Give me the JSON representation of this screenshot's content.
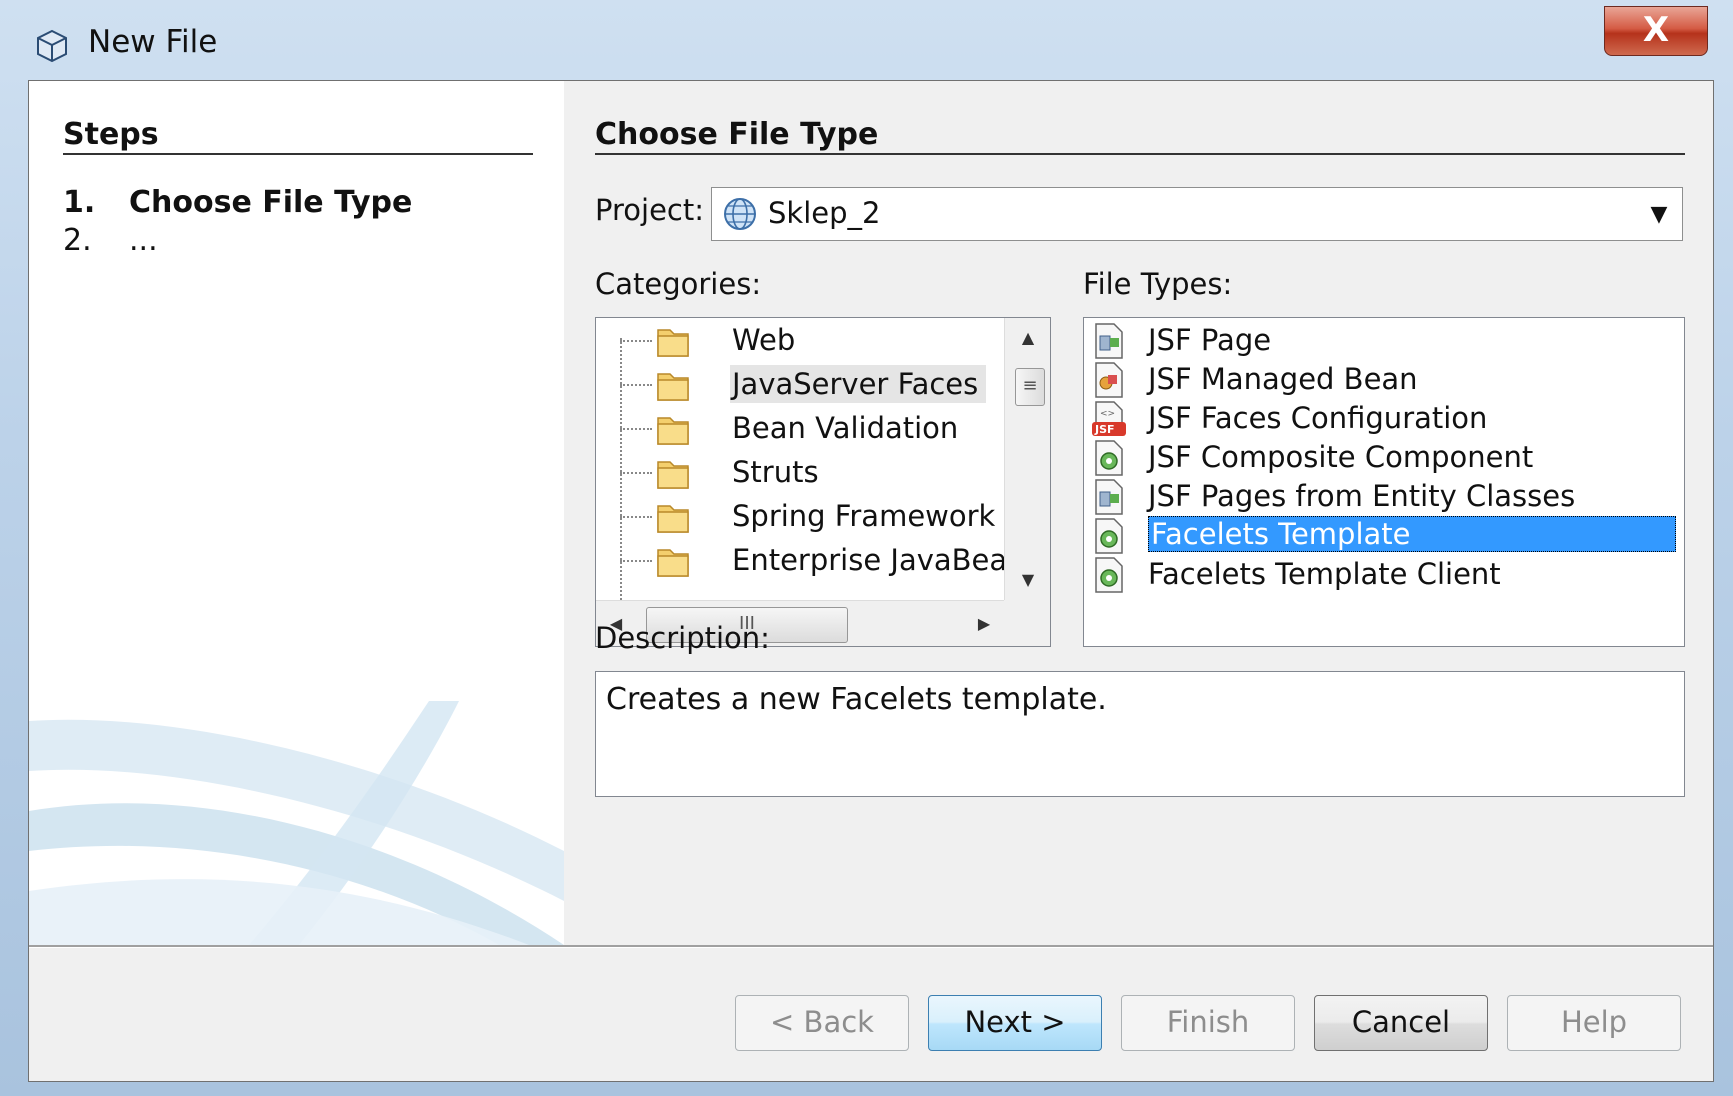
{
  "window": {
    "title": "New File",
    "close_glyph": "X"
  },
  "steps": {
    "heading": "Steps",
    "items": [
      {
        "num": "1.",
        "label": "Choose File Type"
      },
      {
        "num": "2.",
        "label": "..."
      }
    ]
  },
  "main": {
    "heading": "Choose File Type",
    "project_label": "Project:",
    "project_value": "Sklep_2",
    "categories_label": "Categories:",
    "file_types_label": "File Types:",
    "categories": [
      "Web",
      "JavaServer Faces",
      "Bean Validation",
      "Struts",
      "Spring Framework",
      "Enterprise JavaBeans"
    ],
    "categories_selected": "JavaServer Faces",
    "file_types": [
      {
        "label": "JSF Page",
        "icon": "jsf-page-icon"
      },
      {
        "label": "JSF Managed Bean",
        "icon": "managed-bean-icon"
      },
      {
        "label": "JSF Faces Configuration",
        "icon": "faces-config-icon"
      },
      {
        "label": "JSF Composite Component",
        "icon": "composite-component-icon"
      },
      {
        "label": "JSF Pages from Entity Classes",
        "icon": "jsf-pages-entity-icon"
      },
      {
        "label": "Facelets Template",
        "icon": "facelets-template-icon"
      },
      {
        "label": "Facelets Template Client",
        "icon": "facelets-template-client-icon"
      }
    ],
    "file_types_selected": "Facelets Template",
    "description_label": "Description:",
    "description_text": "Creates a new Facelets template."
  },
  "buttons": {
    "back": "< Back",
    "next": "Next >",
    "finish": "Finish",
    "cancel": "Cancel",
    "help": "Help"
  },
  "colors": {
    "selection": "#3399ff",
    "title_bar": "#bcd2e9",
    "close_button": "#c8412a"
  }
}
